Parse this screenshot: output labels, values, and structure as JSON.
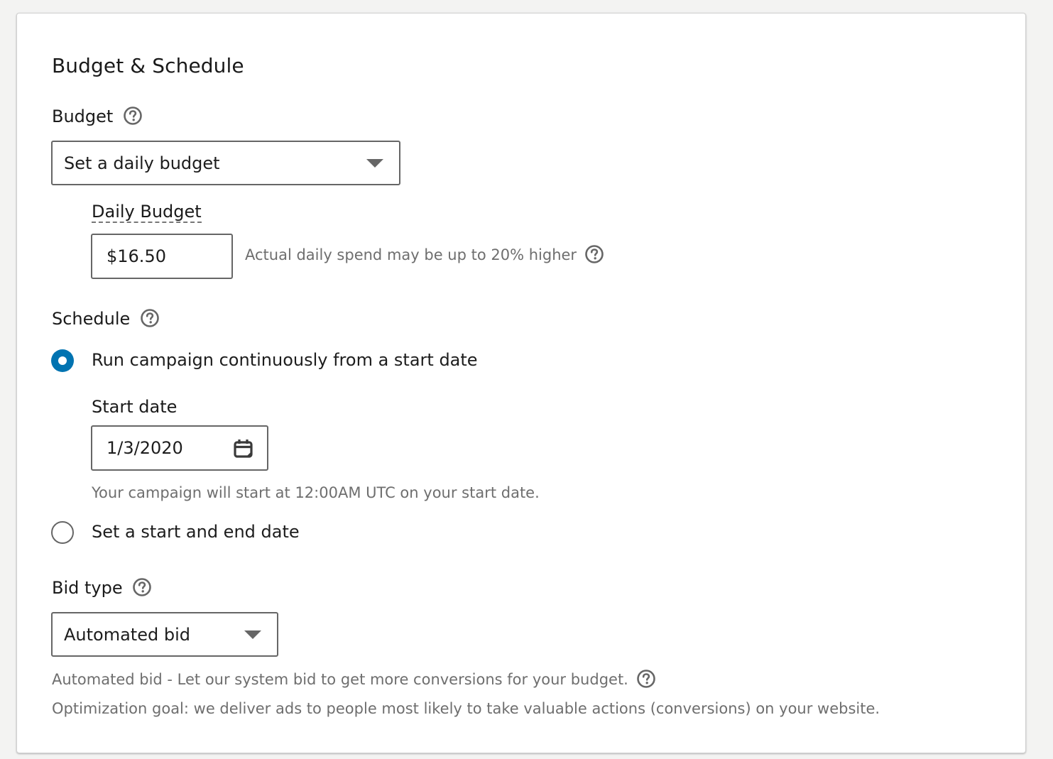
{
  "section_title": "Budget & Schedule",
  "budget": {
    "label": "Budget",
    "help_icon": "question-circle-icon",
    "select_value": "Set a daily budget",
    "daily_budget_label": "Daily Budget",
    "daily_budget_value": "$16.50",
    "daily_budget_hint": "Actual daily spend may be up to 20% higher"
  },
  "schedule": {
    "label": "Schedule",
    "options": [
      {
        "label": "Run campaign continuously from a start date",
        "selected": true
      },
      {
        "label": "Set a start and end date",
        "selected": false
      }
    ],
    "start_date_label": "Start date",
    "start_date_value": "1/3/2020",
    "calendar_icon": "calendar-icon",
    "start_hint": "Your campaign will start at 12:00AM UTC on your start date."
  },
  "bid": {
    "label": "Bid type",
    "select_value": "Automated bid",
    "description": "Automated bid - Let our system bid to get more conversions for your budget.",
    "optimization": "Optimization goal: we deliver ads to people most likely to take valuable actions (conversions) on your website."
  },
  "colors": {
    "accent": "#0073b1",
    "muted_text": "#6e6e6e",
    "border": "#666666"
  }
}
